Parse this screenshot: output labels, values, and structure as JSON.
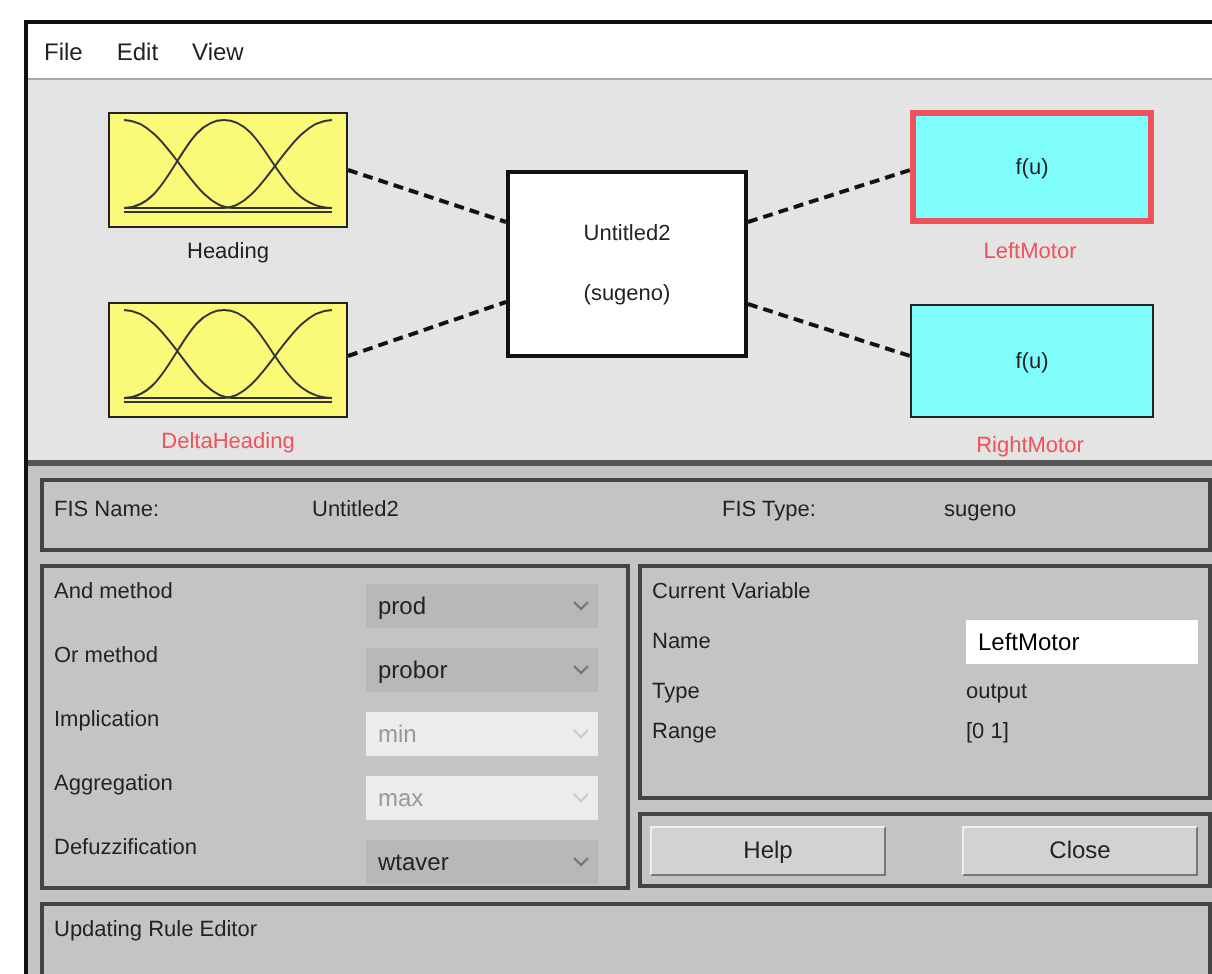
{
  "menu": [
    "File",
    "Edit",
    "View"
  ],
  "diagram": {
    "inputs": [
      {
        "name": "Heading",
        "selected": false,
        "color": "#202020"
      },
      {
        "name": "DeltaHeading",
        "selected": false,
        "color": "#f0525a"
      }
    ],
    "system": {
      "name": "Untitled2",
      "type": "(sugeno)"
    },
    "outputs": [
      {
        "name": "LeftMotor",
        "symbol": "f(u)",
        "selected": true,
        "color": "#f0525a"
      },
      {
        "name": "RightMotor",
        "symbol": "f(u)",
        "selected": false,
        "color": "#f0525a"
      }
    ]
  },
  "fis": {
    "name_label": "FIS Name:",
    "name": "Untitled2",
    "type_label": "FIS Type:",
    "type": "sugeno"
  },
  "methods": [
    {
      "label": "And method",
      "value": "prod",
      "disabled": false
    },
    {
      "label": "Or method",
      "value": "probor",
      "disabled": false
    },
    {
      "label": "Implication",
      "value": "min",
      "disabled": true
    },
    {
      "label": "Aggregation",
      "value": "max",
      "disabled": true
    },
    {
      "label": "Defuzzification",
      "value": "wtaver",
      "disabled": false
    }
  ],
  "current_variable": {
    "title": "Current Variable",
    "name_label": "Name",
    "name": "LeftMotor",
    "type_label": "Type",
    "type": "output",
    "range_label": "Range",
    "range": "[0 1]"
  },
  "buttons": [
    "Help",
    "Close"
  ],
  "status": "Updating Rule Editor"
}
